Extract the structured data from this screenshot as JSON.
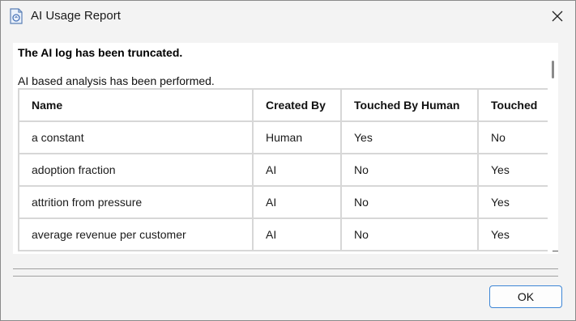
{
  "window": {
    "title": "AI Usage Report",
    "icon": "app-document-icon",
    "close_icon": "close-icon"
  },
  "messages": {
    "truncated": "The AI log has been truncated.",
    "performed": "AI based analysis has been performed."
  },
  "table": {
    "columns": [
      "Name",
      "Created By",
      "Touched By Human",
      "Touched"
    ],
    "rows": [
      [
        "a constant",
        "Human",
        "Yes",
        "No"
      ],
      [
        "adoption fraction",
        "AI",
        "No",
        "Yes"
      ],
      [
        "attrition from pressure",
        "AI",
        "No",
        "Yes"
      ],
      [
        "average revenue per customer",
        "AI",
        "No",
        "Yes"
      ]
    ]
  },
  "buttons": {
    "ok_label": "OK"
  }
}
